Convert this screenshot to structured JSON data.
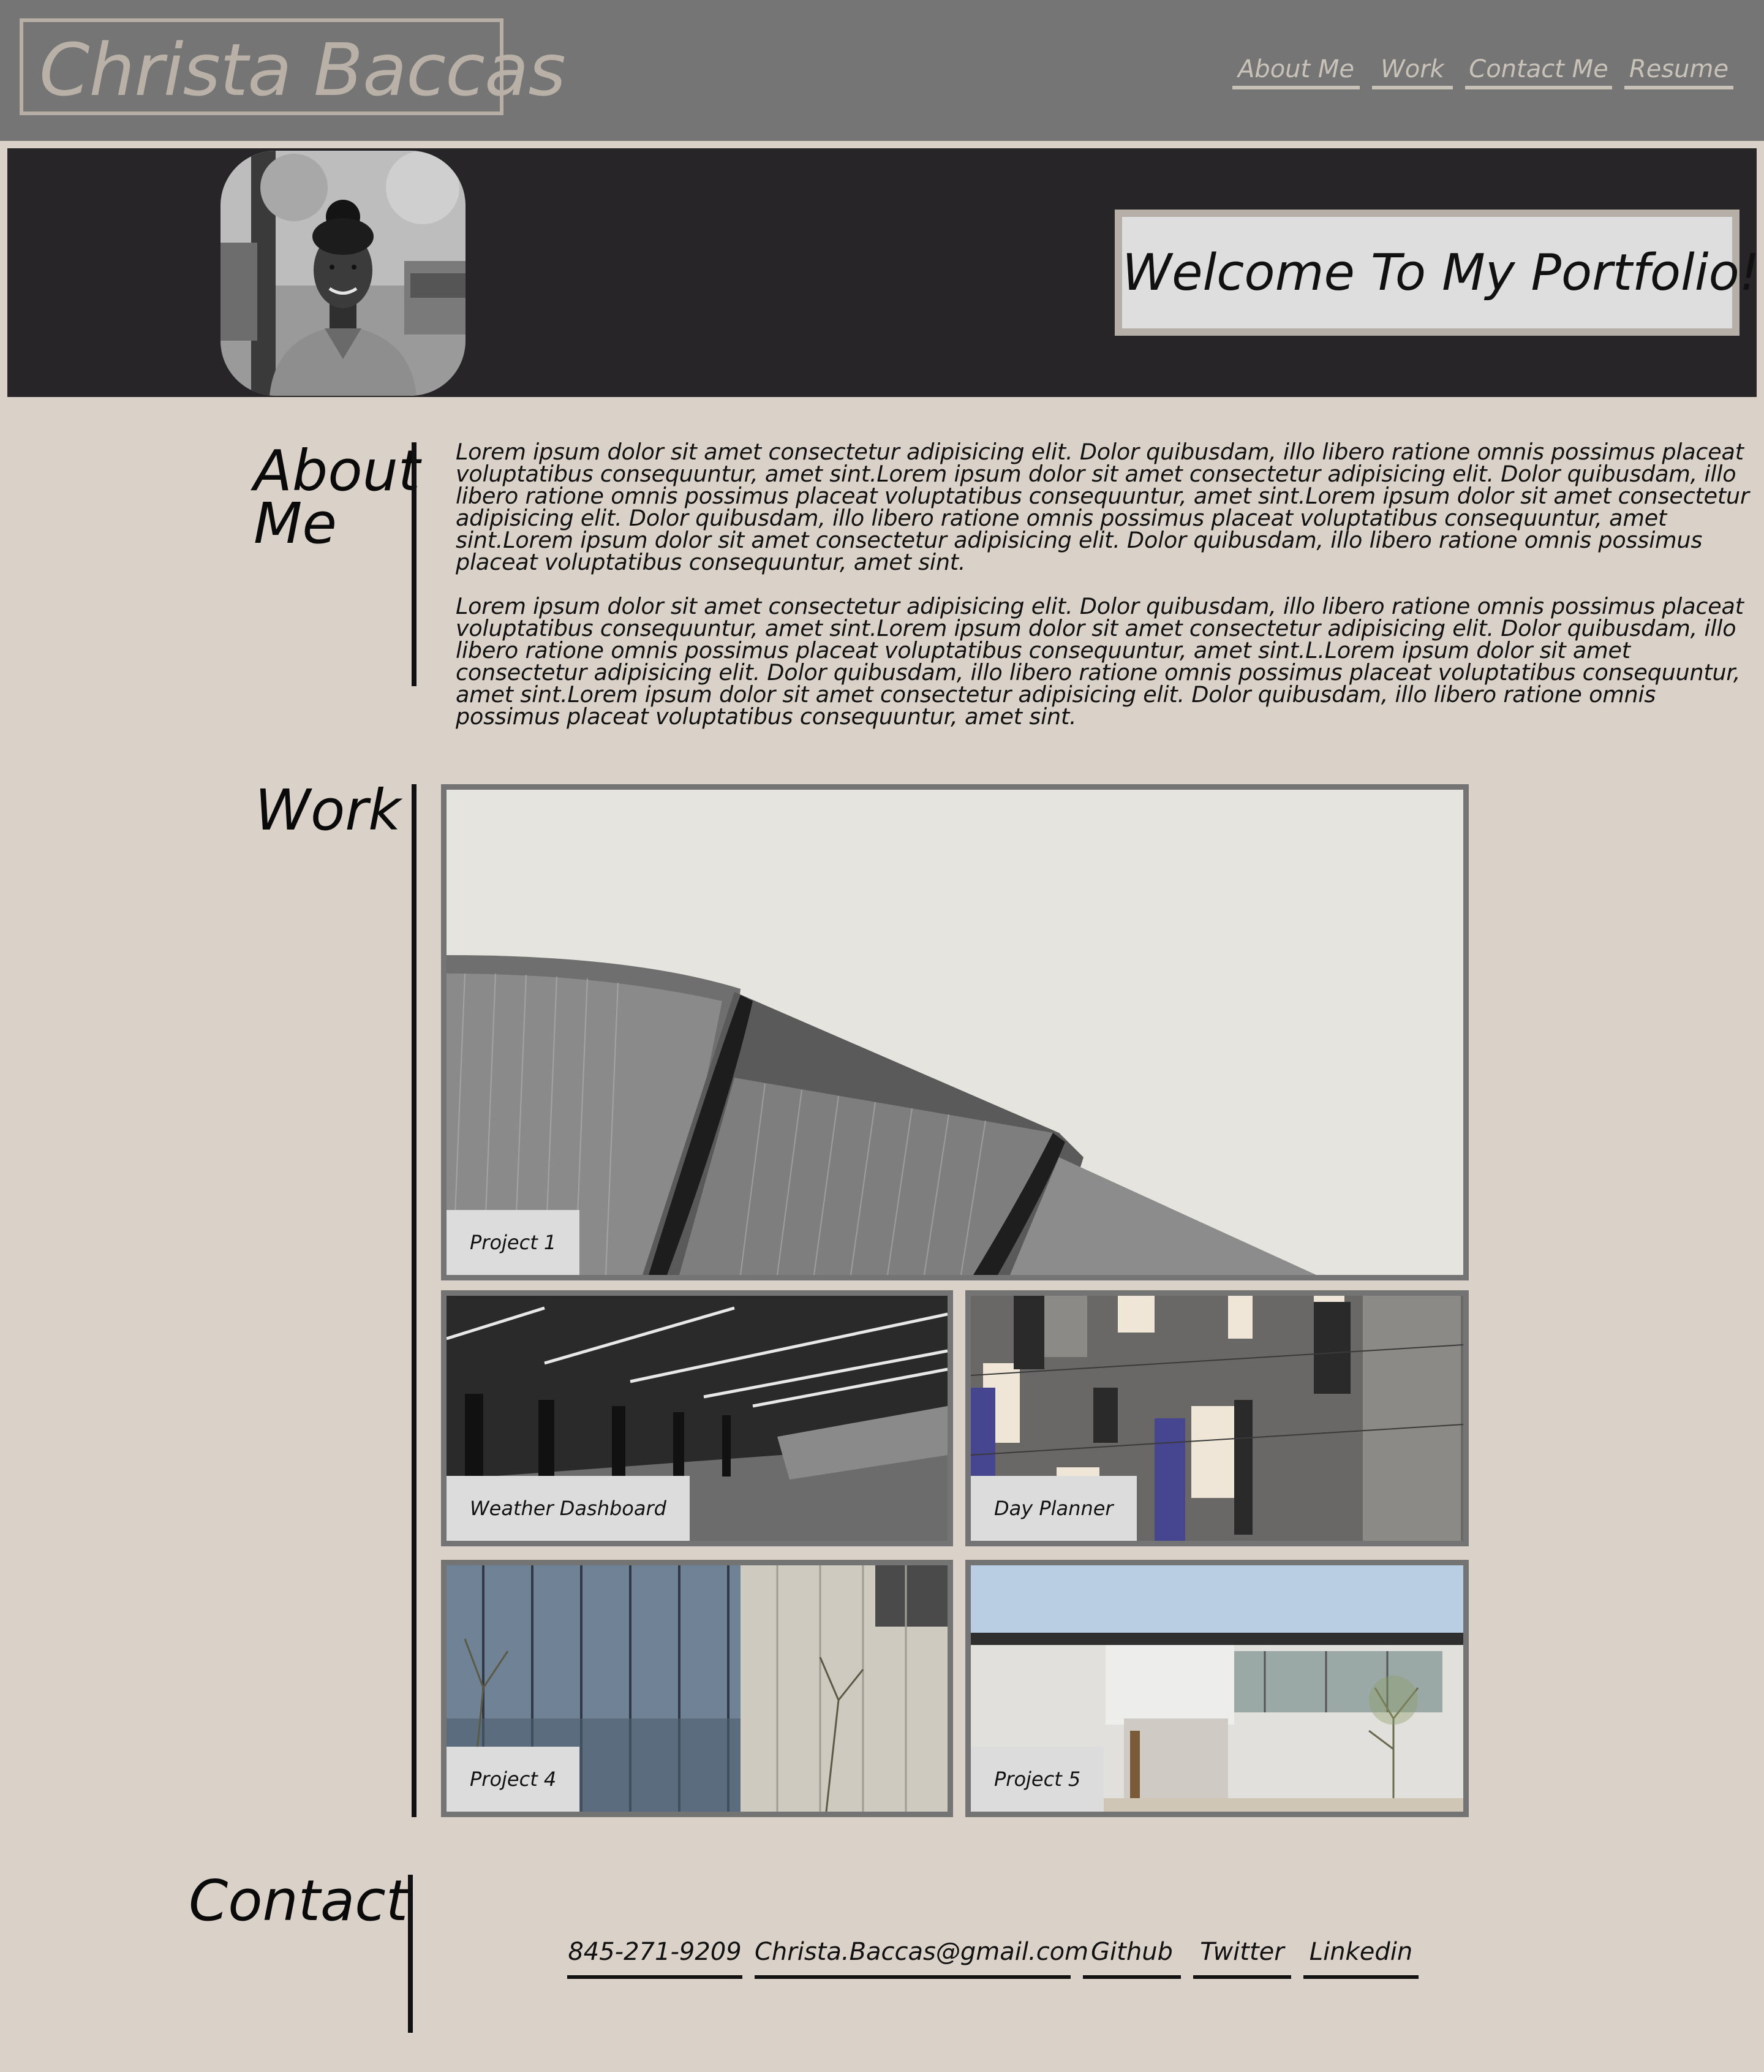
{
  "header": {
    "logo": "Christa Baccas",
    "nav": [
      "About Me",
      "Work",
      "Contact Me",
      "Resume"
    ]
  },
  "banner": {
    "welcome": "Welcome To My Portfolio!"
  },
  "about": {
    "title_line1": "About",
    "title_line2": "Me",
    "paragraphs": [
      "Lorem ipsum dolor sit amet consectetur adipisicing elit. Dolor quibusdam, illo libero ratione omnis possimus placeat voluptatibus consequuntur, amet sint.Lorem ipsum dolor sit amet consectetur adipisicing elit. Dolor quibusdam, illo libero ratione omnis possimus placeat voluptatibus consequuntur, amet sint.Lorem ipsum dolor sit amet consectetur adipisicing elit. Dolor quibusdam, illo libero ratione omnis possimus placeat voluptatibus consequuntur, amet sint.Lorem ipsum dolor sit amet consectetur adipisicing elit. Dolor quibusdam, illo libero ratione omnis possimus placeat voluptatibus consequuntur, amet sint.",
      "Lorem ipsum dolor sit amet consectetur adipisicing elit. Dolor quibusdam, illo libero ratione omnis possimus placeat voluptatibus consequuntur, amet sint.Lorem ipsum dolor sit amet consectetur adipisicing elit. Dolor quibusdam, illo libero ratione omnis possimus placeat voluptatibus consequuntur, amet sint.L.Lorem ipsum dolor sit amet consectetur adipisicing elit. Dolor quibusdam, illo libero ratione omnis possimus placeat voluptatibus consequuntur, amet sint.Lorem ipsum dolor sit amet consectetur adipisicing elit. Dolor quibusdam, illo libero ratione omnis possimus placeat voluptatibus consequuntur, amet sint."
    ]
  },
  "work": {
    "title": "Work",
    "projects": [
      "Project 1",
      "Weather Dashboard",
      "Day Planner",
      "Project 4",
      "Project 5"
    ]
  },
  "contact": {
    "title": "Contact",
    "links": [
      "845-271-9209",
      "Christa.Baccas@gmail.com",
      "Github",
      "Twitter",
      "Linkedin"
    ]
  },
  "colors": {
    "page_bg": "#dad2c9",
    "header_bg": "#757575",
    "banner_bg": "#272527",
    "card_border": "#747474"
  }
}
